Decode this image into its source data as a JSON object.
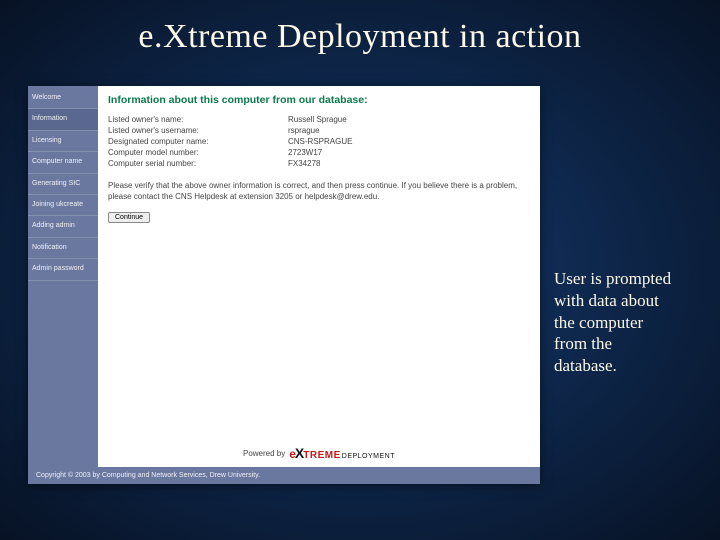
{
  "slide": {
    "title": "e.Xtreme Deployment in action",
    "caption": "User is prompted with data about the computer from the database."
  },
  "sidebar": {
    "items": [
      {
        "label": "Welcome"
      },
      {
        "label": "Information"
      },
      {
        "label": "Licensing"
      },
      {
        "label": "Computer name"
      },
      {
        "label": "Generating SIC"
      },
      {
        "label": "Joining ukcreate"
      },
      {
        "label": "Adding admin"
      },
      {
        "label": "Notification"
      },
      {
        "label": "Admin password"
      }
    ]
  },
  "main": {
    "heading": "Information about this computer from our database:",
    "rows": [
      {
        "label": "Listed owner's name:",
        "value": "Russell Sprague"
      },
      {
        "label": "Listed owner's username:",
        "value": "rsprague"
      },
      {
        "label": "Designated computer name:",
        "value": "CNS-RSPRAGUE"
      },
      {
        "label": "Computer model number:",
        "value": "2723W17"
      },
      {
        "label": "Computer serial number:",
        "value": "FX34278"
      }
    ],
    "verify_text": "Please verify that the above owner information is correct, and then press continue. If you believe there is a problem, please contact the CNS Helpdesk at extension 3205 or helpdesk@drew.edu.",
    "continue_label": "Continue",
    "powered_by": "Powered by",
    "logo_brand_e": "e",
    "logo_brand_x": "X",
    "logo_brand_rest": "TREME",
    "logo_brand_sub": "DEPLOYMENT"
  },
  "footer": {
    "text": "Copyright © 2003 by Computing and Network Services, Drew University."
  }
}
